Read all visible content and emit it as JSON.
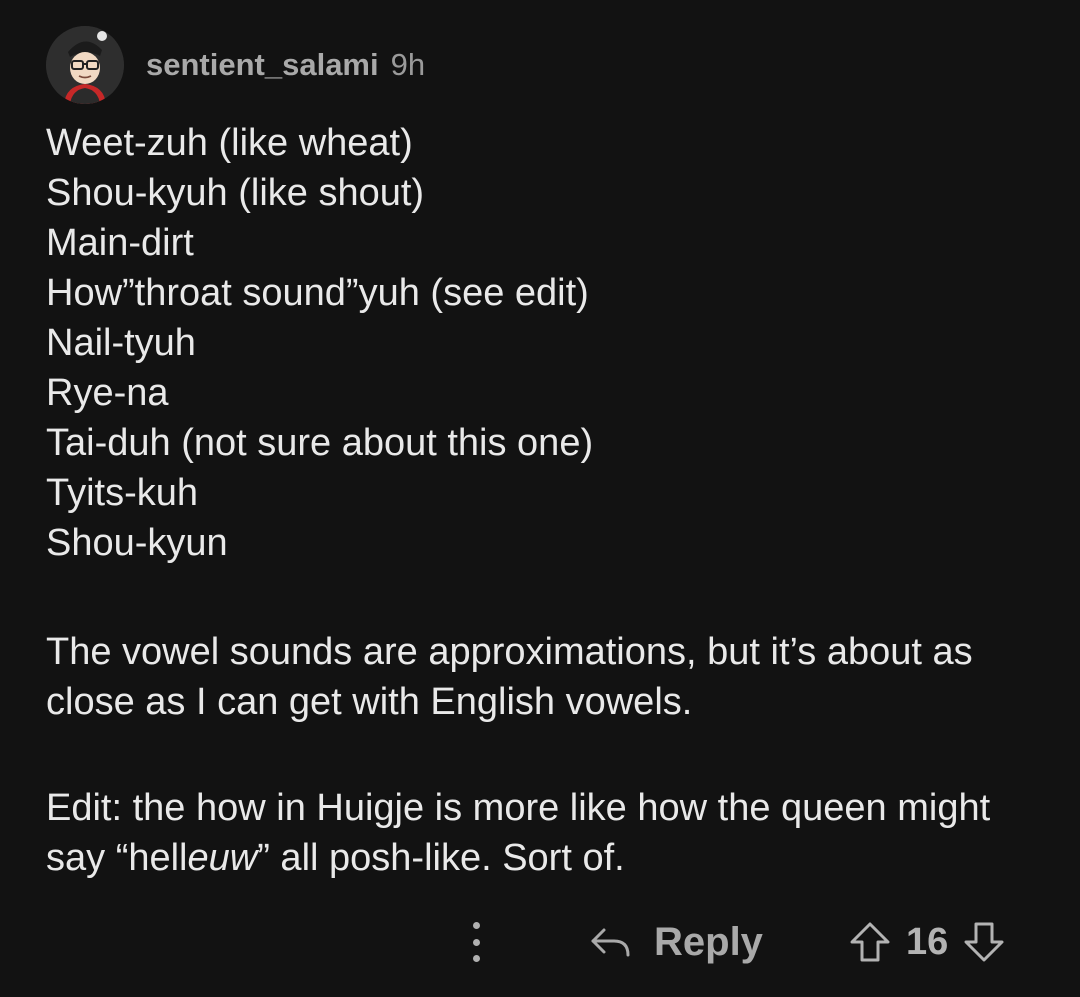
{
  "comment": {
    "author": "sentient_salami",
    "age": "9h",
    "lines": [
      "Weet-zuh (like wheat)",
      "Shou-kyuh (like shout)",
      "Main-dirt",
      "How”throat sound”yuh (see edit)",
      "Nail-tyuh",
      "Rye-na",
      "Tai-duh (not sure about this one)",
      "Tyits-kuh",
      "Shou-kyun"
    ],
    "paragraph_1": "The vowel sounds are approximations, but it’s about as close as I can get with English vowels.",
    "edit_prefix": "Edit: the how in Huigje is more like how the queen might say “hell",
    "edit_italic": "euw",
    "edit_suffix": "” all posh-like. Sort of."
  },
  "actions": {
    "reply_label": "Reply",
    "score": "16"
  },
  "icons": {
    "more": "more-vertical-icon",
    "reply": "reply-arrow-icon",
    "upvote": "upvote-arrow-icon",
    "downvote": "downvote-arrow-icon"
  },
  "colors": {
    "background": "#121212",
    "text": "#e9e9e9",
    "muted": "#a9a9a9"
  }
}
